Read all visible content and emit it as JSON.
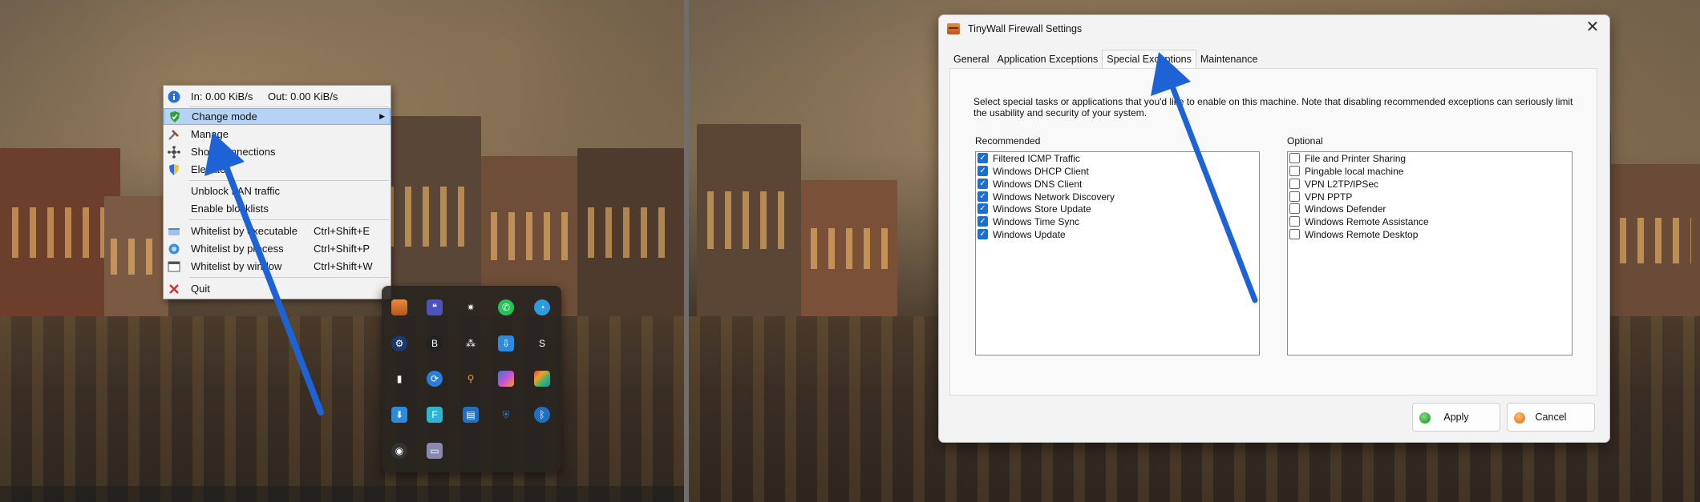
{
  "context_menu": {
    "items": [
      {
        "label": "In: 0.00 KiB/s",
        "extra": "Out: 0.00 KiB/s",
        "icon": "info-icon"
      },
      {
        "label": "Change mode",
        "icon": "shield-icon",
        "highlighted": true,
        "submenu": true
      },
      {
        "label": "Manage",
        "icon": "tools-icon"
      },
      {
        "label": "Show connections",
        "icon": "network-icon"
      },
      {
        "label": "Elevate",
        "icon": "elevate-shield-icon"
      },
      {
        "label": "Unblock LAN traffic"
      },
      {
        "label": "Enable blocklists"
      },
      {
        "label": "Whitelist by executable",
        "shortcut": "Ctrl+Shift+E",
        "icon": "executable-icon"
      },
      {
        "label": "Whitelist by process",
        "shortcut": "Ctrl+Shift+P",
        "icon": "process-icon"
      },
      {
        "label": "Whitelist by window",
        "shortcut": "Ctrl+Shift+W",
        "icon": "window-icon"
      },
      {
        "label": "Quit",
        "icon": "quit-x-icon"
      }
    ]
  },
  "tray": {
    "icons": [
      "tinywall-icon",
      "teams-icon",
      "sun-icon",
      "whatsapp-icon",
      "edge-icon",
      "steam-icon",
      "bitdefender-icon",
      "cluster-icon",
      "download-icon",
      "scrivener-icon",
      "audio-icon",
      "sync-icon",
      "search-key-icon",
      "copilot-icon",
      "office-icon",
      "installer-icon",
      "flow-icon",
      "outlook-icon",
      "defender-icon",
      "bluetooth-icon",
      "nvidia-icon",
      "chat-icon"
    ]
  },
  "window": {
    "title": "TinyWall Firewall Settings",
    "close": "✕",
    "tabs": [
      "General",
      "Application Exceptions",
      "Special Exceptions",
      "Maintenance"
    ],
    "active_tab": "Special Exceptions",
    "description_line1": "Select special tasks or applications that you'd like to enable on this machine. Note that disabling recommended exceptions can seriously limit",
    "description_line2": "the usability and security of your system.",
    "recommended": {
      "label": "Recommended",
      "items": [
        {
          "label": "Filtered ICMP Traffic",
          "checked": true
        },
        {
          "label": "Windows DHCP Client",
          "checked": true
        },
        {
          "label": "Windows DNS Client",
          "checked": true
        },
        {
          "label": "Windows Network Discovery",
          "checked": true
        },
        {
          "label": "Windows Store Update",
          "checked": true
        },
        {
          "label": "Windows Time Sync",
          "checked": true
        },
        {
          "label": "Windows Update",
          "checked": true
        }
      ]
    },
    "optional": {
      "label": "Optional",
      "items": [
        {
          "label": "File and Printer Sharing",
          "checked": false
        },
        {
          "label": "Pingable local machine",
          "checked": false
        },
        {
          "label": "VPN L2TP/IPSec",
          "checked": false
        },
        {
          "label": "VPN PPTP",
          "checked": false
        },
        {
          "label": "Windows Defender",
          "checked": false
        },
        {
          "label": "Windows Remote Assistance",
          "checked": false
        },
        {
          "label": "Windows Remote Desktop",
          "checked": false
        }
      ]
    },
    "buttons": {
      "apply": "Apply",
      "cancel": "Cancel"
    }
  },
  "colors": {
    "accent": "#1a6fd1",
    "arrow": "#1e63d6",
    "highlight": "#b6d3f5"
  }
}
